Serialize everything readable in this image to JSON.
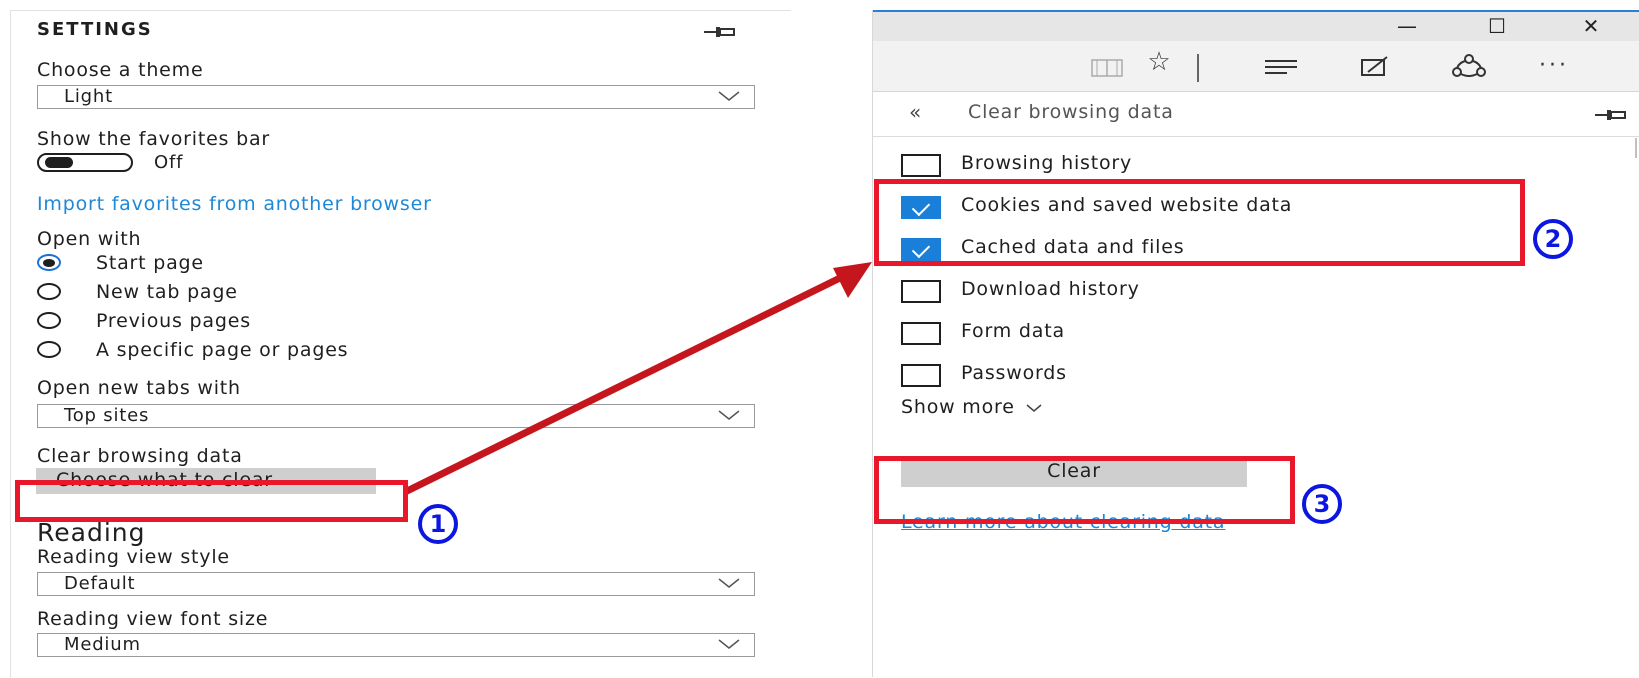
{
  "settings": {
    "title": "SETTINGS",
    "pin_icon": "pin-icon",
    "theme": {
      "label": "Choose a theme",
      "value": "Light"
    },
    "favorites_bar": {
      "label": "Show the favorites bar",
      "state": "Off"
    },
    "import_link": "Import favorites from another browser",
    "open_with": {
      "label": "Open with",
      "options": [
        "Start page",
        "New tab page",
        "Previous pages",
        "A specific page or pages"
      ],
      "selected": "Start page"
    },
    "new_tabs": {
      "label": "Open new tabs with",
      "value": "Top sites"
    },
    "clear": {
      "label": "Clear browsing data",
      "button": "Choose what to clear"
    },
    "reading": {
      "heading": "Reading",
      "style_label": "Reading view style",
      "style_value": "Default",
      "font_label": "Reading view font size",
      "font_value": "Medium"
    }
  },
  "browser": {
    "window_controls": {
      "minimize": "—",
      "maximize": "☐",
      "close": "✕"
    },
    "toolbar_icons": [
      "reading-view-icon",
      "favorites-star-icon",
      "hub-icon",
      "web-note-icon",
      "share-icon",
      "more-icon"
    ],
    "more_glyph": "···",
    "panel": {
      "back_glyph": "«",
      "title": "Clear browsing data",
      "items": [
        {
          "label": "Browsing history",
          "checked": false
        },
        {
          "label": "Cookies and saved website data",
          "checked": true
        },
        {
          "label": "Cached data and files",
          "checked": true
        },
        {
          "label": "Download history",
          "checked": false
        },
        {
          "label": "Form data",
          "checked": false
        },
        {
          "label": "Passwords",
          "checked": false
        }
      ],
      "show_more": "Show more",
      "clear_button": "Clear",
      "learn_more": "Learn more about clearing data"
    }
  },
  "annotations": {
    "step1": "1",
    "step2": "2",
    "step3": "3",
    "accent": "#e8182a",
    "badge_color": "#0b16e0"
  }
}
